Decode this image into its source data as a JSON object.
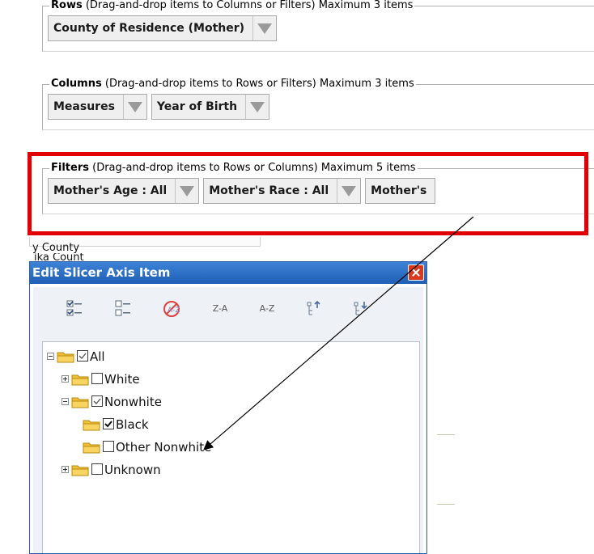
{
  "rows": {
    "title": "Rows",
    "hint": " (Drag-and-drop items to Columns or Filters) Maximum 3 items",
    "chips": [
      {
        "label": "County of Residence (Mother)"
      }
    ]
  },
  "columns": {
    "title": "Columns",
    "hint": " (Drag-and-drop items to Rows or Filters) Maximum 3 items",
    "chips": [
      {
        "label": "Measures"
      },
      {
        "label": "Year of Birth"
      }
    ]
  },
  "filters": {
    "title": "Filters",
    "hint": " (Drag-and-drop items to Rows or Columns) Maximum 5 items",
    "chips": [
      {
        "label": "Mother's Age : All"
      },
      {
        "label": "Mother's Race : All"
      },
      {
        "label": "Mother's"
      }
    ]
  },
  "background_text": {
    "line1": "y County",
    "line2": "ika Count"
  },
  "dialog": {
    "title": "Edit Slicer Axis Item",
    "toolbar": {
      "select_all_icon": "check-all-icon",
      "deselect_all_icon": "uncheck-all-icon",
      "clear_icon": "no-sort-icon",
      "sort_za": "Z-A",
      "sort_az": "A-Z",
      "move_up_icon": "move-up-icon",
      "move_down_icon": "move-down-icon"
    },
    "tree": [
      {
        "label": "All",
        "checked": "partial",
        "expander": "minus"
      },
      {
        "label": "White",
        "checked": "unchecked",
        "expander": "plus"
      },
      {
        "label": "Nonwhite",
        "checked": "partial",
        "expander": "minus"
      },
      {
        "label": "Black",
        "checked": "checked",
        "expander": "none"
      },
      {
        "label": "Other Nonwhite",
        "checked": "unchecked",
        "expander": "none"
      },
      {
        "label": "Unknown",
        "checked": "unchecked",
        "expander": "plus"
      }
    ]
  },
  "colors": {
    "highlight": "#e00000",
    "titlebar": "#2a6ac4",
    "folder": "#f2c037"
  }
}
